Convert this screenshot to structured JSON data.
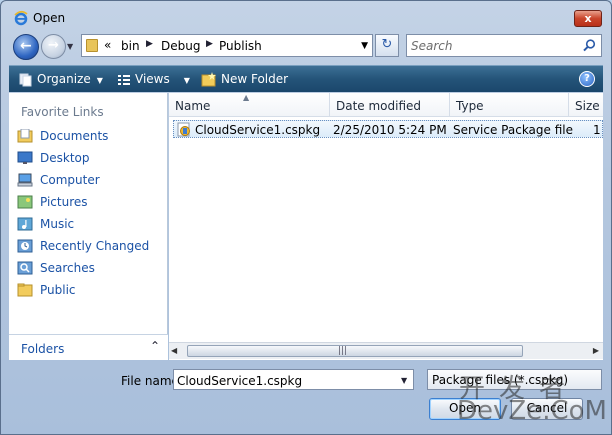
{
  "window": {
    "title": "Open",
    "close_label": "x"
  },
  "address_bar": {
    "prefix": "«",
    "crumbs": [
      "bin",
      "Debug",
      "Publish"
    ]
  },
  "search": {
    "placeholder": "Search"
  },
  "toolbar": {
    "organize_label": "Organize",
    "views_label": "Views",
    "new_folder_label": "New Folder",
    "help_label": "?"
  },
  "favorites": {
    "header": "Favorite Links",
    "items": [
      {
        "label": "Documents",
        "icon": "documents-icon"
      },
      {
        "label": "Desktop",
        "icon": "desktop-icon"
      },
      {
        "label": "Computer",
        "icon": "computer-icon"
      },
      {
        "label": "Pictures",
        "icon": "pictures-icon"
      },
      {
        "label": "Music",
        "icon": "music-icon"
      },
      {
        "label": "Recently Changed",
        "icon": "recently-changed-icon"
      },
      {
        "label": "Searches",
        "icon": "searches-icon"
      },
      {
        "label": "Public",
        "icon": "public-folder-icon"
      }
    ],
    "folders_label": "Folders"
  },
  "columns": [
    "Name",
    "Date modified",
    "Type",
    "Size"
  ],
  "files": [
    {
      "name": "CloudService1.cspkg",
      "date_modified": "2/25/2010 5:24 PM",
      "type": "Service Package file",
      "size": "1"
    }
  ],
  "bottom": {
    "filename_label": "File name:",
    "filename_value": "CloudService1.cspkg",
    "filetype_value": "Package files (*.cspkg)",
    "open_label": "Open",
    "cancel_label": "Cancel"
  },
  "watermark": {
    "line1": "开发者",
    "line2": "DevZe.CoM"
  },
  "colors": {
    "link": "#1b52a5",
    "toolbar": "#245479",
    "selection": "#dcecfa"
  }
}
